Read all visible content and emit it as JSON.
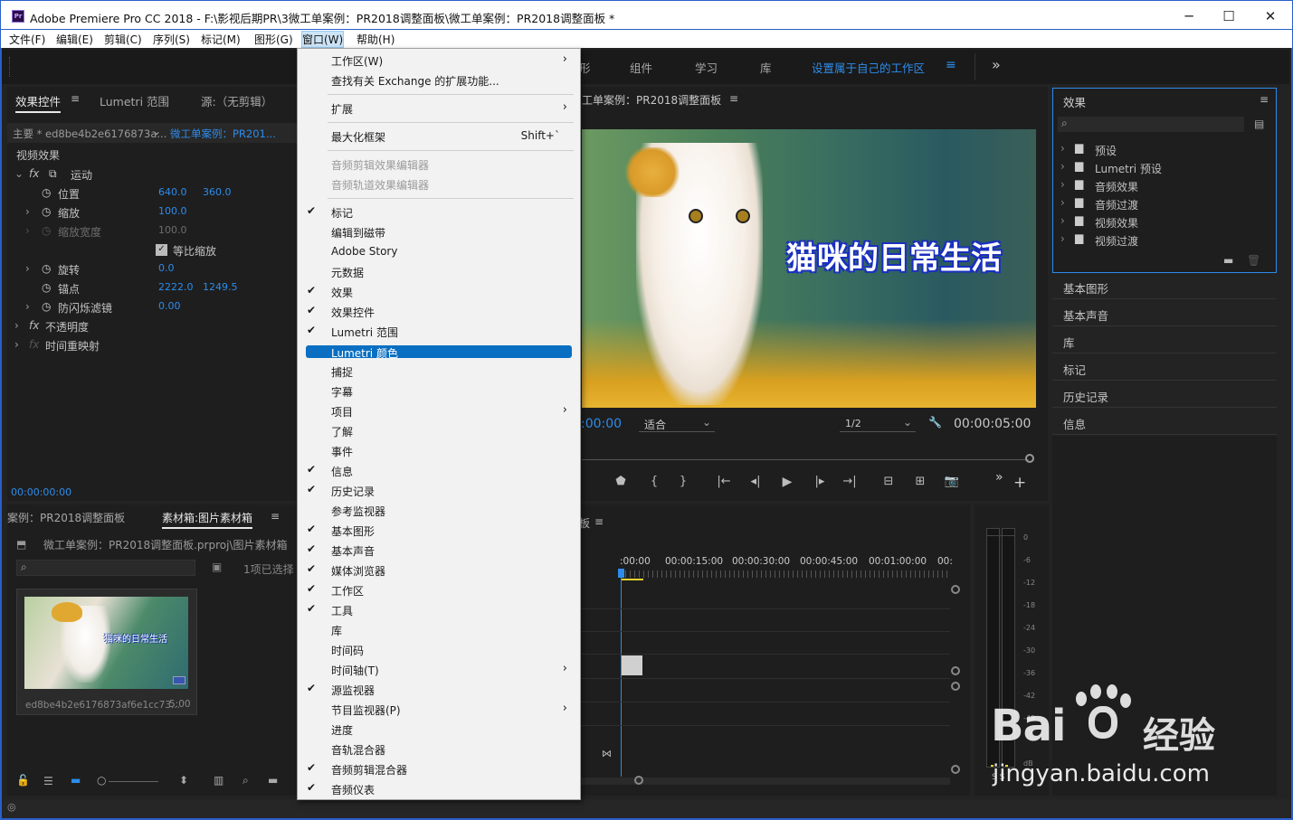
{
  "titlebar": {
    "app_icon": "Pr",
    "title": "Adobe Premiere Pro CC 2018 - F:\\影视后期PR\\3微工单案例：PR2018调整面板\\微工单案例：PR2018调整面板 *",
    "minimize": "─",
    "maximize": "☐",
    "close": "✕"
  },
  "menubar": [
    "文件(F)",
    "编辑(E)",
    "剪辑(C)",
    "序列(S)",
    "标记(M)",
    "图形(G)",
    "窗口(W)",
    "帮助(H)"
  ],
  "workspace_tabs": {
    "items": [
      "形",
      "组件",
      "学习",
      "库",
      "设置属于自己的工作区"
    ],
    "menu_icon": "≡",
    "more": "»"
  },
  "effect_controls": {
    "tabs": [
      "效果控件",
      "Lumetri 范围",
      "源:（无剪辑）"
    ],
    "tab_menu": "≡",
    "master": "主要 * ed8be4b2e6176873a...",
    "sequence": "微工单案例：PR201...",
    "section": "视频效果",
    "fx_label": "fx",
    "motion": "运动",
    "position_label": "位置",
    "position_x": "640.0",
    "position_y": "360.0",
    "scale_label": "缩放",
    "scale": "100.0",
    "scale_width_label": "缩放宽度",
    "scale_width": "100.0",
    "uniform_scale": "等比缩放",
    "rotation_label": "旋转",
    "rotation": "0.0",
    "anchor_label": "锚点",
    "anchor_x": "2222.0",
    "anchor_y": "1249.5",
    "flicker_label": "防闪烁滤镜",
    "flicker": "0.00",
    "opacity": "不透明度",
    "time_remap": "时间重映射",
    "timecode": "00:00:00:00"
  },
  "program_monitor": {
    "title": "工单案例：PR2018调整面板",
    "title_menu": "≡",
    "video_text": "猫咪的日常生活",
    "timecode": ":00:00",
    "fit": "适合",
    "resolution": "1/2",
    "duration": "00:00:05:00",
    "wrench_icon": "🔧"
  },
  "playback_controls": [
    "⬟",
    "{",
    "}",
    "|←",
    "◂|",
    "▶",
    "|▸",
    "→|",
    "⊟",
    "⊞",
    "📷"
  ],
  "playback_more": "»",
  "playback_add": "+",
  "effects_panel": {
    "title": "效果",
    "menu": "≡",
    "search_placeholder": "",
    "items": [
      "预设",
      "Lumetri 预设",
      "音频效果",
      "音频过渡",
      "视频效果",
      "视频过渡"
    ]
  },
  "side_panels": [
    "基本图形",
    "基本声音",
    "库",
    "标记",
    "历史记录",
    "信息"
  ],
  "project_panel": {
    "tab1": "案例：PR2018调整面板",
    "tab2": "素材箱:图片素材箱",
    "tab_menu": "≡",
    "path": "微工单案例：PR2018调整面板.prproj\\图片素材箱",
    "selection": "1项已选择",
    "clip_name": "ed8be4b2e6176873af6e1cc73...",
    "clip_duration": "5:00",
    "thumb_text": "猫咪的日常生活"
  },
  "timeline": {
    "title": "板",
    "title_menu": "≡",
    "ruler": [
      ":00:00",
      "00:00:15:00",
      "00:00:30:00",
      "00:00:45:00",
      "00:01:00:00",
      "00:"
    ]
  },
  "audio_meter": {
    "scale": [
      "0",
      "-6",
      "-12",
      "-18",
      "-24",
      "-30",
      "-36",
      "-42",
      "-48",
      "dB"
    ],
    "solo": "S  S"
  },
  "window_menu": {
    "items": [
      {
        "label": "工作区(W)",
        "arrow": true
      },
      {
        "label": "查找有关 Exchange 的扩展功能..."
      },
      {
        "sep": true
      },
      {
        "label": "扩展",
        "arrow": true
      },
      {
        "sep": true
      },
      {
        "label": "最大化框架",
        "shortcut": "Shift+`"
      },
      {
        "sep": true
      },
      {
        "label": "音频剪辑效果编辑器",
        "disabled": true
      },
      {
        "label": "音频轨道效果编辑器",
        "disabled": true
      },
      {
        "sep": true
      },
      {
        "label": "标记",
        "checked": true
      },
      {
        "label": "编辑到磁带"
      },
      {
        "label": "Adobe Story"
      },
      {
        "label": "元数据"
      },
      {
        "label": "效果",
        "checked": true
      },
      {
        "label": "效果控件",
        "checked": true
      },
      {
        "label": "Lumetri 范围",
        "checked": true
      },
      {
        "label": "Lumetri 颜色",
        "highlighted": true
      },
      {
        "label": "捕捉"
      },
      {
        "label": "字幕"
      },
      {
        "label": "项目",
        "arrow": true
      },
      {
        "label": "了解"
      },
      {
        "label": "事件"
      },
      {
        "label": "信息",
        "checked": true
      },
      {
        "label": "历史记录",
        "checked": true
      },
      {
        "label": "参考监视器"
      },
      {
        "label": "基本图形",
        "checked": true
      },
      {
        "label": "基本声音",
        "checked": true
      },
      {
        "label": "媒体浏览器",
        "checked": true
      },
      {
        "label": "工作区",
        "checked": true
      },
      {
        "label": "工具",
        "checked": true
      },
      {
        "label": "库"
      },
      {
        "label": "时间码"
      },
      {
        "label": "时间轴(T)",
        "arrow": true
      },
      {
        "label": "源监视器",
        "checked": true
      },
      {
        "label": "节目监视器(P)",
        "arrow": true
      },
      {
        "label": "进度"
      },
      {
        "label": "音轨混合器"
      },
      {
        "label": "音频剪辑混合器",
        "checked": true
      },
      {
        "label": "音频仪表",
        "checked": true
      }
    ]
  },
  "watermark": {
    "brand": "Bai",
    "brand2": "经验",
    "url": "jingyan.baidu.com"
  },
  "colors": {
    "accent": "#2d8ceb",
    "menu_highlight": "#0a6fc2",
    "panel_bg": "#1e1e1e",
    "app_bg": "#232323",
    "window_border": "#2b5fc9"
  }
}
